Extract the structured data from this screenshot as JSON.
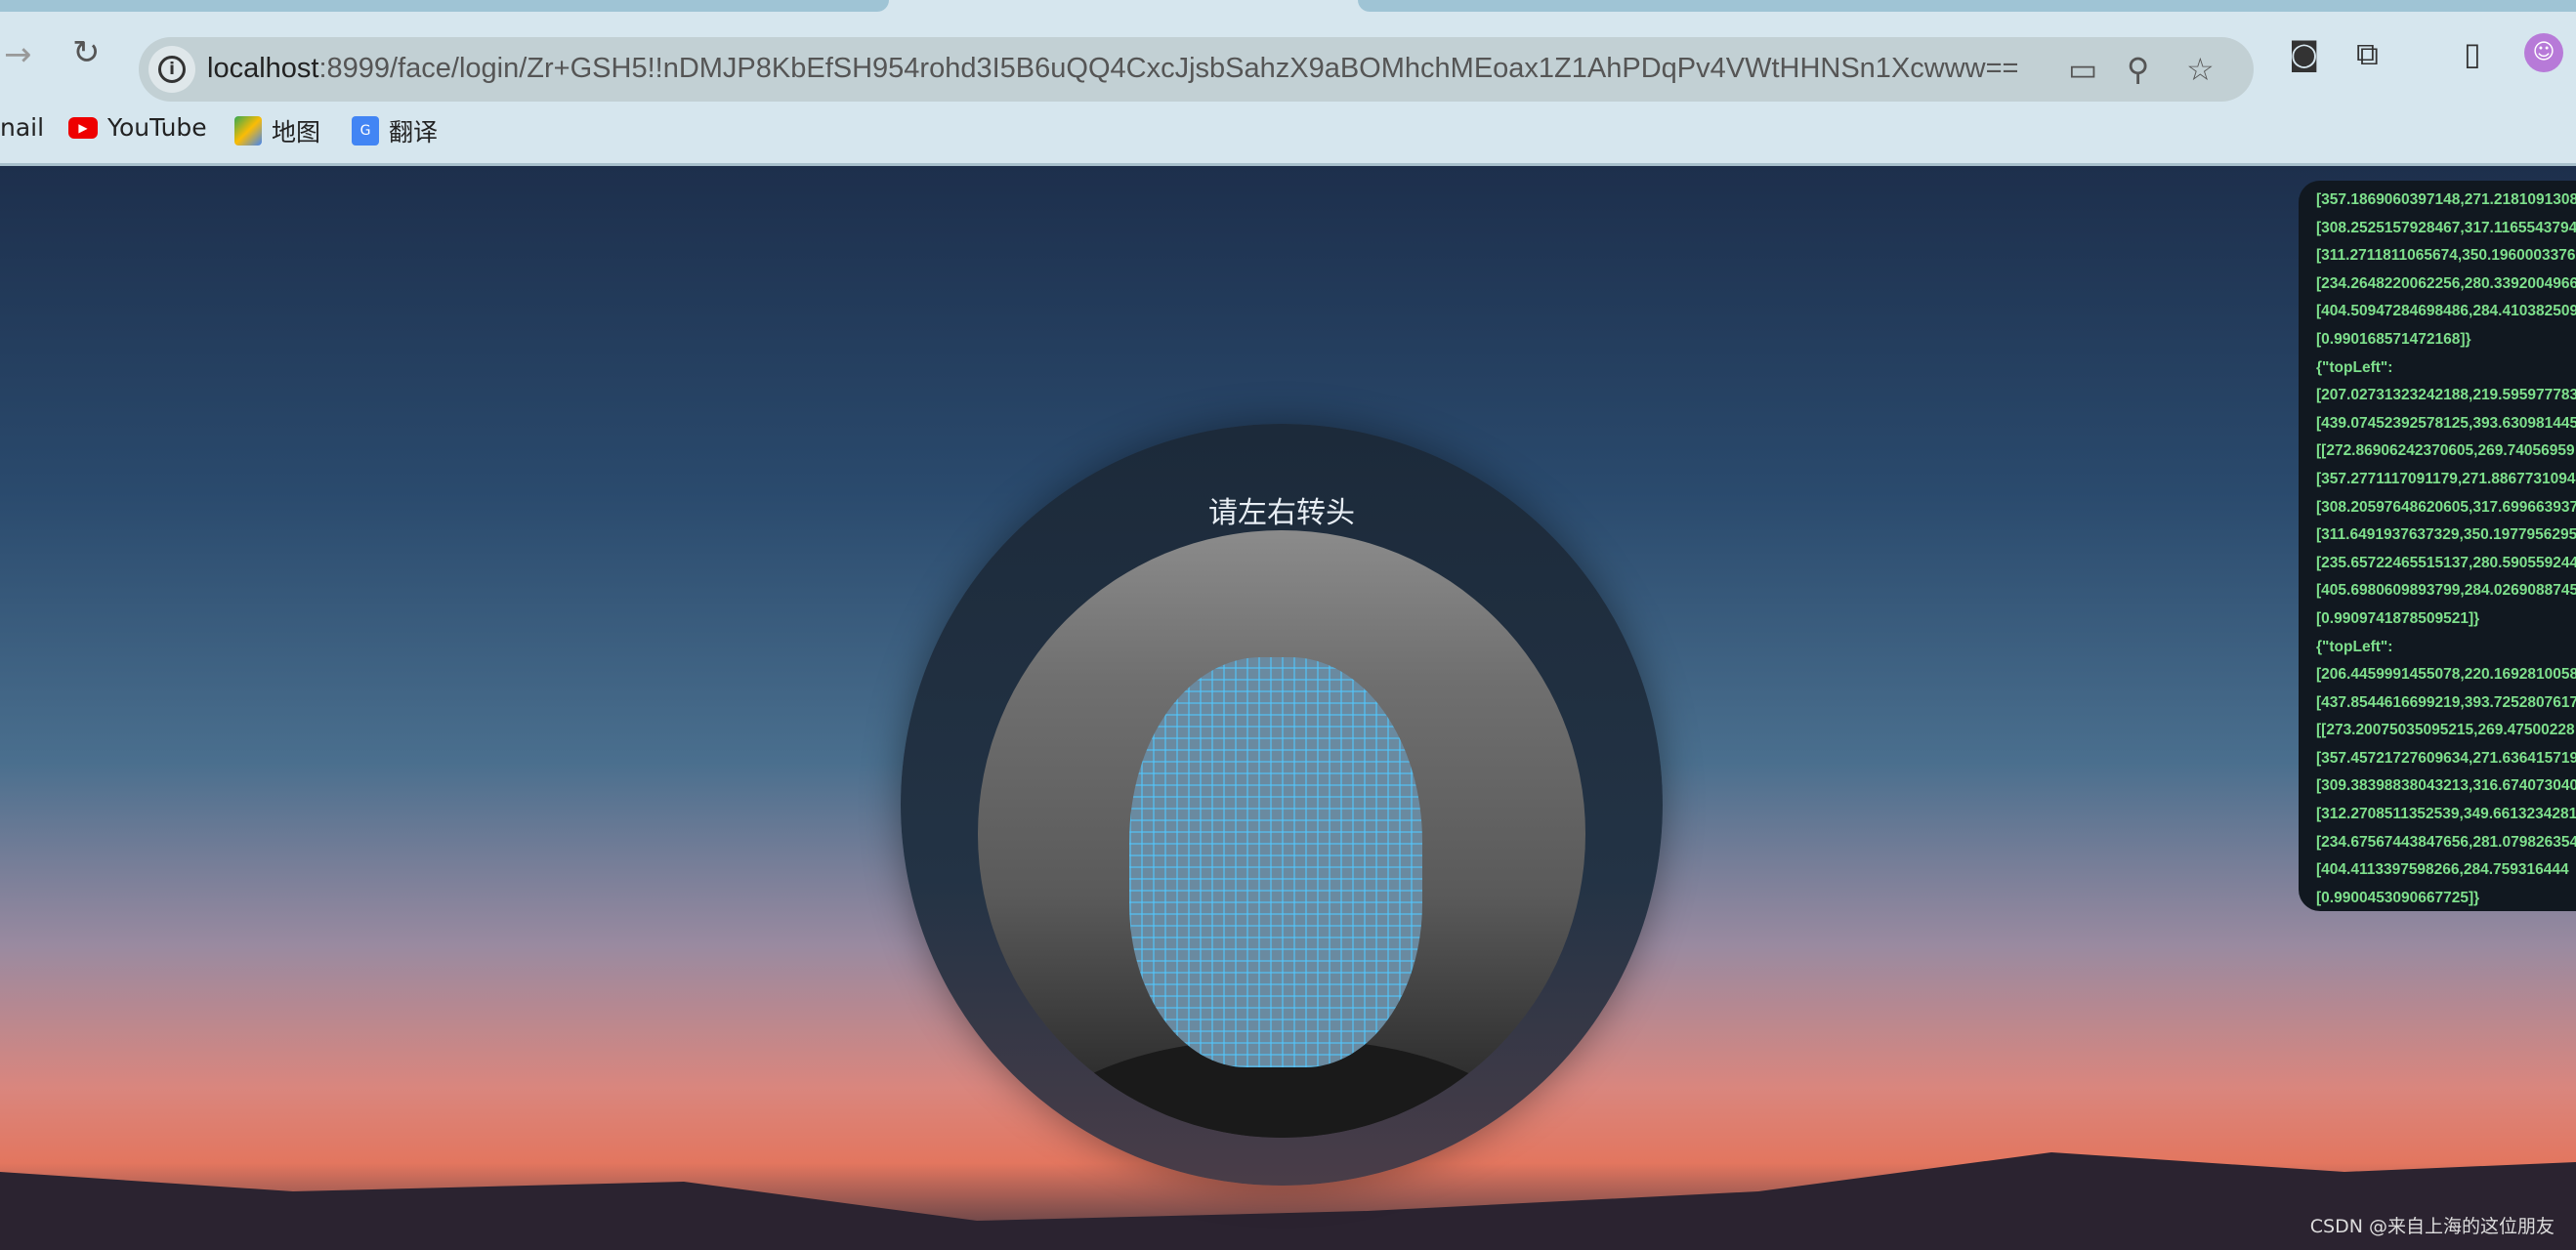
{
  "browser": {
    "url_host": "localhost",
    "url_rest": ":8999/face/login/Zr+GSH5!!nDMJP8KbEfSH954rohd3I5B6uQQ4CxcJjsbSahzX9aBOMhchMEoax1Z1AhPDqPv4VWtHHNSn1Xcwww==",
    "icons": [
      "forward-icon",
      "reload-icon",
      "info-icon",
      "camera-icon",
      "zoom-icon",
      "star-icon",
      "extension-a-icon",
      "puzzle-icon",
      "sidepanel-icon",
      "avatar-icon"
    ],
    "bookmarks": [
      {
        "label": "nail",
        "icon": "gmail-icon"
      },
      {
        "label": "YouTube",
        "icon": "youtube-icon"
      },
      {
        "label": "地图",
        "icon": "maps-icon"
      },
      {
        "label": "翻译",
        "icon": "translate-icon"
      }
    ]
  },
  "main": {
    "prompt": "请左右转头"
  },
  "log": {
    "lines": [
      "[357.1869060397148,271.2181091308",
      "[308.2525157928467,317.1165543794",
      "[311.2711811065674,350.1960003376",
      "[234.2648220062256,280.3392004966",
      "[404.50947284698486,284.410382509",
      "[0.990168571472168]}",
      "{\"topLeft\":",
      "[207.02731323242188,219.595977783",
      "[439.07452392578125,393.630981445",
      "[[272.86906242370605,269.74056959",
      "[357.2771117091179,271.8867731094",
      "[308.20597648620605,317.699663937",
      "[311.6491937637329,350.1977956295",
      "[235.65722465515137,280.590559244",
      "[405.6980609893799,284.0269088745",
      "[0.9909741878509521]}",
      "{\"topLeft\":",
      "[206.4459991455078,220.1692810058",
      "[437.8544616699219,393.7252807617",
      "[[273.20075035095215,269.47500228",
      "[357.45721727609634,271.636415719",
      "[309.38398838043213,316.674073040",
      "[312.2708511352539,349.6613234281",
      "[234.67567443847656,281.079826354",
      "[404.4113397598266,284.759316444",
      "[0.9900453090667725]}"
    ]
  },
  "watermark": "CSDN @来自上海的这位朋友"
}
